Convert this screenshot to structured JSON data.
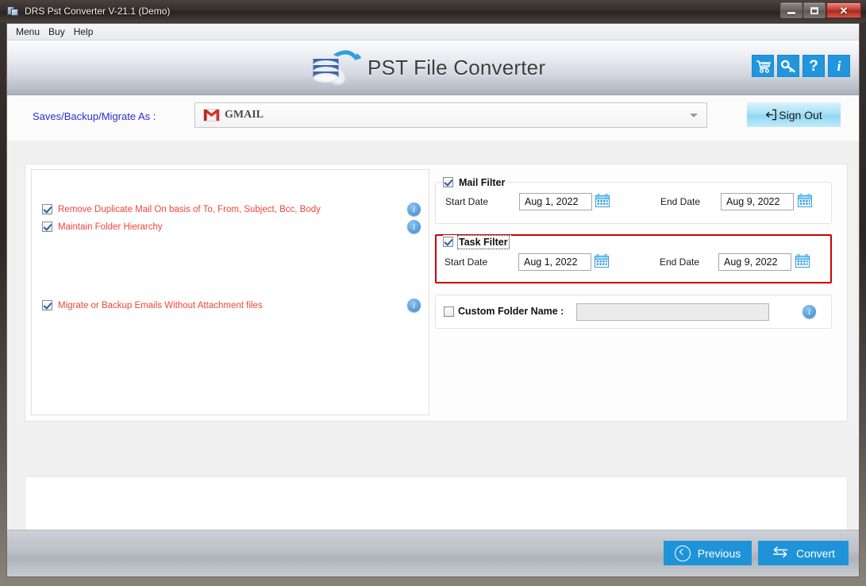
{
  "window": {
    "title": "DRS Pst Converter V-21.1 (Demo)",
    "app_icon": "app-window-icon",
    "controls": {
      "minimize": "minimize-icon",
      "maximize": "maximize-icon",
      "close": "✕"
    }
  },
  "menubar": {
    "items": [
      {
        "label": "Menu"
      },
      {
        "label": "Buy"
      },
      {
        "label": "Help"
      }
    ]
  },
  "header": {
    "brand_text": "PST File Converter",
    "logo": "database-stack-icon",
    "icons": [
      {
        "name": "cart-icon",
        "glyph": "🛒"
      },
      {
        "name": "key-icon",
        "glyph": "🔑"
      },
      {
        "name": "help-icon",
        "glyph": "?"
      },
      {
        "name": "info-icon",
        "glyph": "i"
      }
    ]
  },
  "account": {
    "label": "Saves/Backup/Migrate As :",
    "selected_value": "GMAIL",
    "provider_icon": "gmail-icon",
    "dropdown_icon": "chevron-down-icon",
    "signout_label": "Sign Out",
    "signout_icon": "sign-out-icon"
  },
  "options": {
    "items": [
      {
        "label": "Remove Duplicate Mail On basis of To, From, Subject, Bcc, Body",
        "checked": true,
        "info": "i"
      },
      {
        "label": "Maintain Folder Hierarchy",
        "checked": true,
        "info": "i"
      },
      {
        "label": "Migrate or Backup Emails Without Attachment files",
        "checked": true,
        "info": "i"
      }
    ]
  },
  "filters": [
    {
      "title": "Mail Filter",
      "checked": true,
      "highlighted": false,
      "focused": false,
      "start_label": "Start Date",
      "start_value": "Aug 1, 2022",
      "end_label": "End Date",
      "end_value": "Aug 9, 2022",
      "calendar_icon": "calendar-icon"
    },
    {
      "title": "Task Filter",
      "checked": true,
      "highlighted": true,
      "focused": true,
      "start_label": "Start Date",
      "start_value": "Aug 1, 2022",
      "end_label": "End Date",
      "end_value": "Aug 9, 2022",
      "calendar_icon": "calendar-icon"
    }
  ],
  "custom_folder": {
    "label": "Custom Folder Name :",
    "checked": false,
    "value": "",
    "enabled": false,
    "info": "i"
  },
  "footer": {
    "previous_label": "Previous",
    "previous_icon": "circle-chevron-left-icon",
    "convert_label": "Convert",
    "convert_icon": "convert-arrows-icon"
  },
  "colors": {
    "accent_blue": "#1f93d8",
    "header_icon_blue": "#2196dd",
    "option_text_red": "#f0453c",
    "highlight_red": "#cc0000",
    "label_blue": "#2d2dd4"
  }
}
